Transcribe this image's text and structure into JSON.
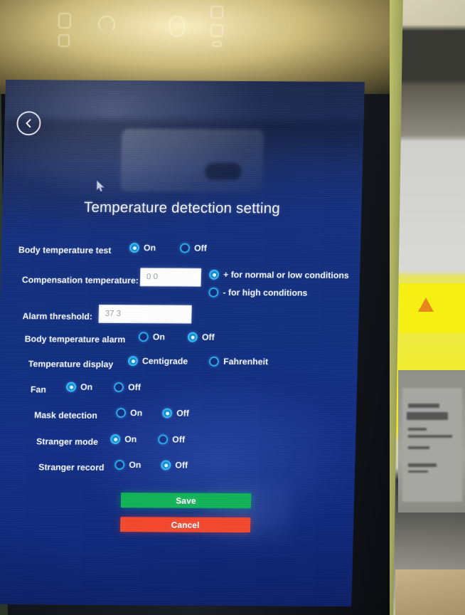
{
  "screen": {
    "back_button_icon": "chevron-left-icon",
    "title": "Temperature detection setting"
  },
  "settings": {
    "body_temperature_test": {
      "label": "Body temperature test",
      "options": [
        "On",
        "Off"
      ],
      "selected": "On"
    },
    "compensation_temperature": {
      "label": "Compensation temperature:",
      "value": "0 0",
      "placeholder": "0 0",
      "sign_options": [
        "+ for normal or low conditions",
        "- for high conditions"
      ],
      "sign_selected": "+ for normal or low conditions"
    },
    "alarm_threshold": {
      "label": "Alarm threshold:",
      "value": "37 3",
      "placeholder": "37 3"
    },
    "body_temperature_alarm": {
      "label": "Body temperature alarm",
      "options": [
        "On",
        "Off"
      ],
      "selected": "Off"
    },
    "temperature_display": {
      "label": "Temperature display",
      "options": [
        "Centigrade",
        "Fahrenheit"
      ],
      "selected": "Centigrade"
    },
    "fan": {
      "label": "Fan",
      "options": [
        "On",
        "Off"
      ],
      "selected": "On"
    },
    "mask_detection": {
      "label": "Mask detection",
      "options": [
        "On",
        "Off"
      ],
      "selected": "Off"
    },
    "stranger_mode": {
      "label": "Stranger mode",
      "options": [
        "On",
        "Off"
      ],
      "selected": "On"
    },
    "stranger_record": {
      "label": "Stranger record",
      "options": [
        "On",
        "Off"
      ],
      "selected": "Off"
    }
  },
  "actions": {
    "save_label": "Save",
    "cancel_label": "Cancel"
  },
  "colors": {
    "screen_blue": "#12307f",
    "radio_accent": "#2aa7e8",
    "save_green": "#12b458",
    "cancel_red": "#f4482f",
    "text_white": "#eef2fa"
  }
}
